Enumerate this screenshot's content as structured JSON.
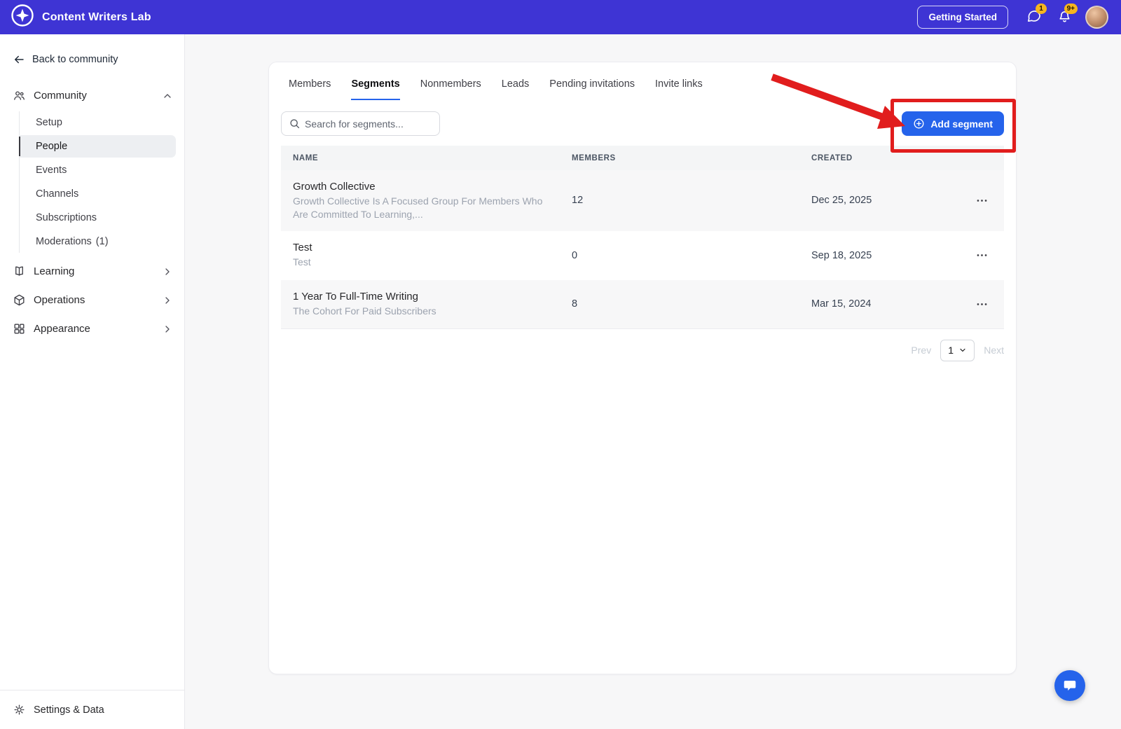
{
  "topbar": {
    "app_title": "Content Writers Lab",
    "getting_started_label": "Getting Started",
    "messages_badge": "1",
    "notifications_badge": "9+"
  },
  "sidebar": {
    "back_label": "Back to community",
    "community": {
      "label": "Community",
      "items": [
        {
          "label": "Setup",
          "active": false
        },
        {
          "label": "People",
          "active": true
        },
        {
          "label": "Events",
          "active": false
        },
        {
          "label": "Channels",
          "active": false
        },
        {
          "label": "Subscriptions",
          "active": false
        },
        {
          "label": "Moderations",
          "count": "(1)",
          "active": false
        }
      ]
    },
    "groups": [
      {
        "label": "Learning"
      },
      {
        "label": "Operations"
      },
      {
        "label": "Appearance"
      }
    ],
    "footer_label": "Settings & Data"
  },
  "main": {
    "tabs": [
      {
        "label": "Members",
        "active": false
      },
      {
        "label": "Segments",
        "active": true
      },
      {
        "label": "Nonmembers",
        "active": false
      },
      {
        "label": "Leads",
        "active": false
      },
      {
        "label": "Pending invitations",
        "active": false
      },
      {
        "label": "Invite links",
        "active": false
      }
    ],
    "search_placeholder": "Search for segments...",
    "add_segment_label": "Add segment",
    "table": {
      "headers": [
        "NAME",
        "MEMBERS",
        "CREATED"
      ],
      "rows": [
        {
          "name": "Growth Collective",
          "description": "Growth Collective Is A Focused Group For Members Who Are Committed To Learning,...",
          "members": "12",
          "created": "Dec 25, 2025"
        },
        {
          "name": "Test",
          "description": "Test",
          "members": "0",
          "created": "Sep 18, 2025"
        },
        {
          "name": "1 Year To Full-Time Writing",
          "description": "The Cohort For Paid Subscribers",
          "members": "8",
          "created": "Mar 15, 2024"
        }
      ]
    },
    "pagination": {
      "prev_label": "Prev",
      "page": "1",
      "next_label": "Next"
    }
  },
  "icons": {
    "logo-icon": "four-point-star-in-ring",
    "messages-icon": "speech-bubble",
    "notifications-icon": "bell",
    "back-arrow-icon": "arrow-left",
    "community-icon": "people-group",
    "learning-icon": "open-book",
    "operations-icon": "cube",
    "appearance-icon": "layout-grid",
    "settings-icon": "gear",
    "search-icon": "magnifying-glass",
    "add-icon": "plus-in-circle",
    "row-actions-icon": "ellipsis",
    "chat-widget-icon": "chat-bubble"
  },
  "colors": {
    "topbar_bg": "#3e34d4",
    "accent_blue": "#2563eb",
    "annotation_red": "#e11d1d",
    "badge_yellow": "#f6b51e"
  }
}
